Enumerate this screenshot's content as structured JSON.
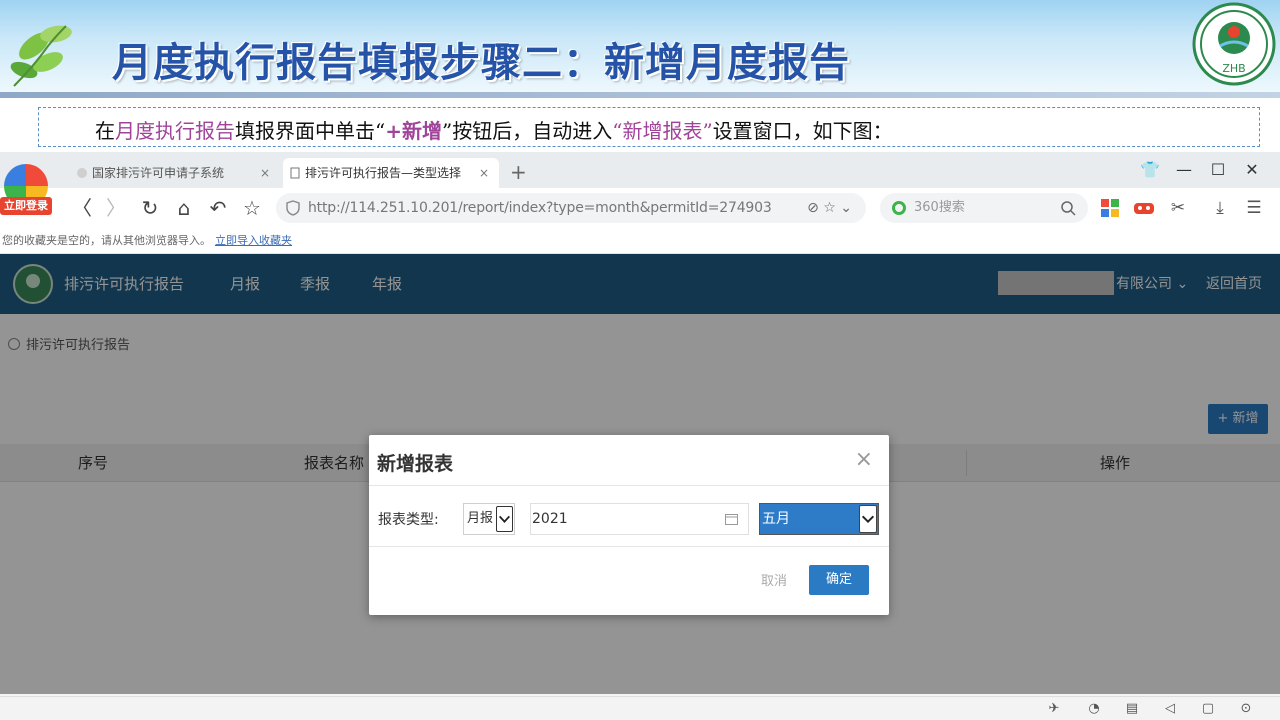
{
  "slide": {
    "title": "月度执行报告填报步骤二：新增月度报告",
    "zhb_logo_text": "ZHB",
    "instruction": {
      "p1": "在",
      "p2": "月度执行报告",
      "p3": "填报界面中单击“",
      "p4": "+新增",
      "p5": "”按钮",
      "p6": "后，自动进入",
      "p7": "“新增报表”",
      "p8": "设置窗口，如下图："
    }
  },
  "browser": {
    "login_badge": "立即登录",
    "tabs": [
      {
        "label": "国家排污许可申请子系统",
        "close": "×"
      },
      {
        "label": "排污许可执行报告—类型选择",
        "close": "×"
      }
    ],
    "new_tab": "+",
    "window_controls": {
      "skin": "👕",
      "minimize": "—",
      "maximize": "☐",
      "close": "✕"
    },
    "nav": {
      "back": "〈",
      "forward": "〉",
      "reload": "↻",
      "home": "⌂",
      "undo": "↶",
      "star": "☆"
    },
    "url": "http://114.251.10.201/report/index?type=month&permitId=274903",
    "url_actions": "⊘ ☆ ⌄",
    "search_placeholder": "360搜索",
    "bookmark_text": "您的收藏夹是空的，请从其他浏览器导入。",
    "bookmark_link": "立即导入收藏夹"
  },
  "app": {
    "name": "排污许可执行报告",
    "nav_items": [
      "月报",
      "季报",
      "年报"
    ],
    "company_suffix": "有限公司 ⌄",
    "back_home": "返回首页",
    "breadcrumb": "排污许可执行报告",
    "add_button": "+ 新增",
    "table_headers": [
      "序号",
      "报表名称",
      "操作"
    ]
  },
  "modal": {
    "title": "新增报表",
    "close": "×",
    "label": "报表类型:",
    "report_type": "月报",
    "year": "2021",
    "month": "五月",
    "cancel": "取消",
    "confirm": "确定"
  },
  "colors": {
    "title_blue": "#2453a8",
    "highlight_purple": "#a0449a",
    "nav_blue": "#1f5d86",
    "button_blue": "#2a7bc4"
  }
}
